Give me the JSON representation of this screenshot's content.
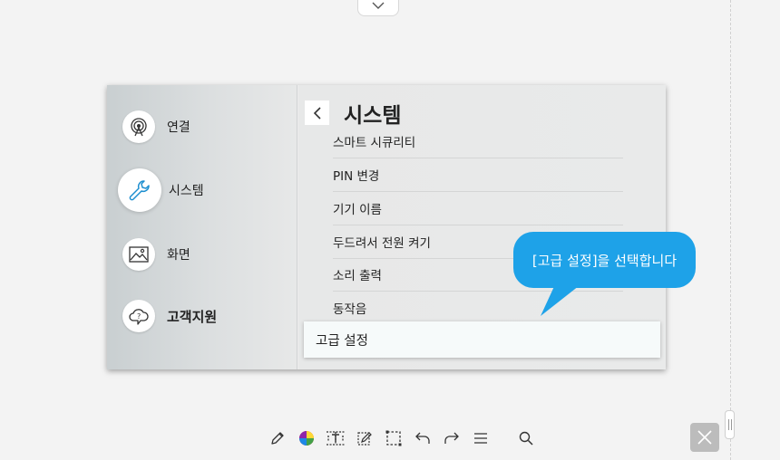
{
  "sidebar": {
    "items": [
      {
        "label": "연결",
        "icon": "antenna-icon"
      },
      {
        "label": "시스템",
        "icon": "wrench-icon"
      },
      {
        "label": "화면",
        "icon": "image-icon"
      },
      {
        "label": "고객지원",
        "icon": "cloud-help-icon"
      }
    ]
  },
  "panel": {
    "title": "시스템",
    "items": [
      "스마트 시큐리티",
      "PIN 변경",
      "기기 이름",
      "두드려서 전원 켜기",
      "소리 출력",
      "동작음",
      "고급 설정"
    ],
    "selected_item": "고급 설정"
  },
  "callout": {
    "text": "[고급 설정]을 선택합니다"
  },
  "toolbar": {
    "tools": [
      "pen-icon",
      "color-wheel-icon",
      "text-box-icon",
      "edit-note-icon",
      "select-area-icon",
      "undo-icon",
      "redo-icon",
      "menu-icon",
      "search-icon"
    ]
  },
  "colors": {
    "callout": "#1ea2e8",
    "background": "#f3f3f3",
    "close_button": "#bcbcbc"
  }
}
